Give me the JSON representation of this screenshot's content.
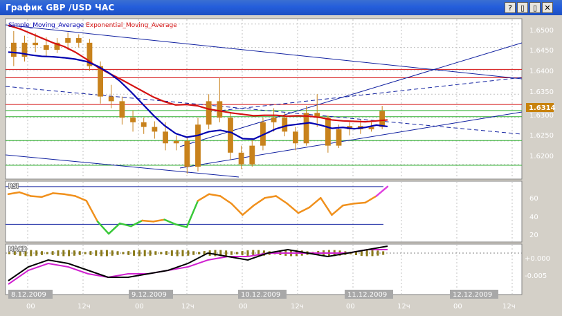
{
  "window": {
    "title": "График GBP /USD  ЧАС",
    "buttons": [
      {
        "name": "help-button",
        "glyph": "?"
      },
      {
        "name": "restore-button",
        "glyph": "▯"
      },
      {
        "name": "maximize-button",
        "glyph": "▯"
      },
      {
        "name": "close-button",
        "glyph": "✕"
      }
    ]
  },
  "legend": {
    "sma": "Simple_Moving_Average",
    "ema": "Exponential_Moving_Average"
  },
  "colors": {
    "background": "#ffffff",
    "grid": "#c0c0c0",
    "axis_panel": "#d4d0c8",
    "candle": "#c8821c",
    "sma": "#0000b0",
    "ema": "#d41010",
    "rsi_line": "#f0901c",
    "rsi_green": "#38c838",
    "rsi_magenta": "#e040e0",
    "macd_black": "#000000",
    "macd_magenta": "#d020d0",
    "macd_hist": "#8a7a1a",
    "price_badge": "#c8820c"
  },
  "price_axis": {
    "ticks": [
      "1.6500",
      "1.6450",
      "1.6400",
      "1.6350",
      "1.6300",
      "1.6250",
      "1.6200"
    ],
    "current": "1.6314"
  },
  "rsi_axis": {
    "label": "RSI",
    "ticks": [
      "60",
      "40",
      "20"
    ]
  },
  "macd_axis": {
    "label": "MACD",
    "ticks": [
      "+0.000",
      "-0.005"
    ]
  },
  "time_axis": {
    "dates": [
      "8.12.2009",
      "9.12.2009",
      "10.12.2009",
      "11.12.2009",
      "12.12.2009"
    ],
    "hours": [
      "00",
      "12ч",
      "00",
      "12ч",
      "00",
      "12ч",
      "00",
      "12ч",
      "00",
      "12ч"
    ]
  },
  "chart_data": {
    "type": "candlestick",
    "title": "График GBP /USD  ЧАС",
    "ylim": [
      1.617,
      1.651
    ],
    "series": [
      {
        "name": "Simple_Moving_Average",
        "values": [
          1.644,
          1.6438,
          1.6434,
          1.6431,
          1.643,
          1.6428,
          1.6425,
          1.642,
          1.641,
          1.6396,
          1.6378,
          1.6355,
          1.633,
          1.6305,
          1.6283,
          1.6266,
          1.6258,
          1.6262,
          1.627,
          1.6273,
          1.6268,
          1.6255,
          1.6254,
          1.6265,
          1.6276,
          1.6283,
          1.6286,
          1.6289,
          1.6284,
          1.6277,
          1.6279,
          1.6276,
          1.6279,
          1.6284,
          1.6281
        ]
      },
      {
        "name": "Exponential_Moving_Average",
        "values": [
          1.6497,
          1.649,
          1.648,
          1.647,
          1.646,
          1.6452,
          1.644,
          1.6425,
          1.6408,
          1.6395,
          1.6383,
          1.637,
          1.6357,
          1.6344,
          1.6334,
          1.6327,
          1.6328,
          1.6325,
          1.6318,
          1.6314,
          1.631,
          1.6307,
          1.6304,
          1.6305,
          1.6305,
          1.6303,
          1.6304,
          1.6303,
          1.63,
          1.6295,
          1.6293,
          1.6292,
          1.6291,
          1.6293,
          1.6295
        ]
      }
    ],
    "horizontal_levels": {
      "red": [
        1.6403,
        1.6385,
        1.6328
      ],
      "green": [
        1.6315,
        1.6302,
        1.6251,
        1.6198
      ]
    },
    "candles": [
      [
        1.646,
        1.6485,
        1.641,
        1.643
      ],
      [
        1.643,
        1.6475,
        1.642,
        1.646
      ],
      [
        1.646,
        1.648,
        1.644,
        1.6455
      ],
      [
        1.6455,
        1.6472,
        1.643,
        1.6445
      ],
      [
        1.6445,
        1.647,
        1.6438,
        1.646
      ],
      [
        1.646,
        1.6482,
        1.6445,
        1.647
      ],
      [
        1.647,
        1.6478,
        1.645,
        1.646
      ],
      [
        1.646,
        1.6468,
        1.64,
        1.641
      ],
      [
        1.641,
        1.642,
        1.633,
        1.6345
      ],
      [
        1.6345,
        1.637,
        1.632,
        1.6335
      ],
      [
        1.6335,
        1.6345,
        1.6285,
        1.63
      ],
      [
        1.63,
        1.6315,
        1.627,
        1.629
      ],
      [
        1.629,
        1.63,
        1.6265,
        1.628
      ],
      [
        1.628,
        1.6292,
        1.6255,
        1.627
      ],
      [
        1.627,
        1.629,
        1.623,
        1.6245
      ],
      [
        1.6245,
        1.6262,
        1.623,
        1.625
      ],
      [
        1.625,
        1.626,
        1.618,
        1.6195
      ],
      [
        1.6195,
        1.63,
        1.6185,
        1.6285
      ],
      [
        1.6285,
        1.635,
        1.6275,
        1.6335
      ],
      [
        1.6335,
        1.6385,
        1.629,
        1.63
      ],
      [
        1.63,
        1.631,
        1.621,
        1.6225
      ],
      [
        1.6225,
        1.624,
        1.619,
        1.62
      ],
      [
        1.62,
        1.6255,
        1.6195,
        1.624
      ],
      [
        1.624,
        1.63,
        1.623,
        1.629
      ],
      [
        1.629,
        1.632,
        1.627,
        1.63
      ],
      [
        1.63,
        1.631,
        1.626,
        1.627
      ],
      [
        1.627,
        1.628,
        1.623,
        1.6245
      ],
      [
        1.6245,
        1.6325,
        1.624,
        1.631
      ],
      [
        1.631,
        1.635,
        1.628,
        1.63
      ],
      [
        1.63,
        1.6305,
        1.6225,
        1.624
      ],
      [
        1.624,
        1.6285,
        1.6235,
        1.6275
      ],
      [
        1.6275,
        1.629,
        1.6262,
        1.6282
      ],
      [
        1.6282,
        1.6295,
        1.6265,
        1.6275
      ],
      [
        1.6275,
        1.629,
        1.627,
        1.628
      ],
      [
        1.628,
        1.6325,
        1.6275,
        1.6314
      ]
    ],
    "rsi_values": [
      62,
      64,
      60,
      59,
      63,
      62,
      60,
      55,
      33,
      20,
      31,
      28,
      34,
      33,
      35,
      30,
      27,
      55,
      62,
      60,
      52,
      40,
      50,
      58,
      60,
      52,
      42,
      48,
      58,
      40,
      50,
      52,
      53,
      60,
      70
    ],
    "macd_black": [
      -0.008,
      -0.004,
      -0.002,
      -0.003,
      -0.005,
      -0.007,
      -0.007,
      -0.006,
      -0.005,
      -0.003,
      0.0,
      -0.001,
      -0.002,
      0.0,
      0.001,
      0.0,
      -0.001,
      0.0,
      0.001,
      0.002
    ],
    "macd_magenta": [
      -0.009,
      -0.005,
      -0.003,
      -0.004,
      -0.006,
      -0.007,
      -0.006,
      -0.006,
      -0.005,
      -0.004,
      -0.002,
      -0.001,
      -0.001,
      0.0,
      0.0,
      0.0,
      0.0,
      0.0,
      0.001,
      0.001
    ]
  }
}
